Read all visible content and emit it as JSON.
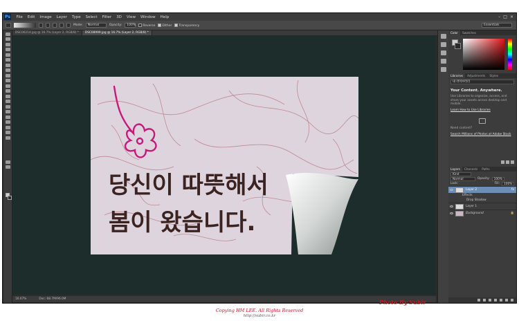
{
  "menubar": {
    "logo": "Ps",
    "items": [
      "File",
      "Edit",
      "Image",
      "Layer",
      "Type",
      "Select",
      "Filter",
      "3D",
      "View",
      "Window",
      "Help"
    ],
    "window_controls": [
      "–",
      "□",
      "×"
    ]
  },
  "options_bar": {
    "mode_label": "Mode:",
    "mode_value": "Normal",
    "opacity_label": "Opacity:",
    "opacity_value": "100%",
    "reverse_label": "Reverse",
    "dither_label": "Dither",
    "transparency_label": "Transparency",
    "workspace": "Essentials"
  },
  "document_tabs": [
    {
      "label": "DSC06214.jpg @ 16.7% (Layer 2, RGB/8) *"
    },
    {
      "label": "DSC08999.jpg @ 16.7% (Layer 2, RGB/8) *"
    }
  ],
  "status_bar": {
    "zoom": "16.67%",
    "doc_size": "Doc: 68.7M/96.0M"
  },
  "color_panel": {
    "tabs": [
      "Color",
      "Swatches"
    ],
    "accent": "#e0151a"
  },
  "libraries_panel": {
    "tabs": [
      "Libraries",
      "Adjustments",
      "Styles"
    ],
    "selected_library": "내 라이브러리",
    "heading": "Your Content. Anywhere.",
    "body": "Use Libraries to organize, access, and share your assets across desktop and mobile.",
    "learn_link": "Learn How to Use Libraries",
    "stock_text": "Need content?",
    "stock_link": "Search Millions of Photos at Adobe Stock"
  },
  "layers_panel": {
    "tabs": [
      "Layers",
      "Channels",
      "Paths"
    ],
    "filter": "Kind",
    "blend_mode": "Normal",
    "opacity_label": "Opacity:",
    "opacity_value": "100%",
    "lock_label": "Lock:",
    "fill_label": "Fill:",
    "fill_value": "100%",
    "layers": [
      {
        "name": "Layer 2",
        "selected": true,
        "fx": "fx"
      },
      {
        "name": "Effects",
        "sub": true
      },
      {
        "name": "Drop Shadow",
        "sub": true
      },
      {
        "name": "Layer 1"
      },
      {
        "name": "Background",
        "locked": true
      }
    ]
  },
  "canvas_content": {
    "korean_line1": "당신이 따뜻해서",
    "korean_line2": "봄이 왔습니다.",
    "flower_color": "#c8187a"
  },
  "footer": {
    "copyright": "Copying HM LEE. All Rights Reserved",
    "url": "http://subir.co.kr",
    "credit": "Photo By Subir"
  }
}
